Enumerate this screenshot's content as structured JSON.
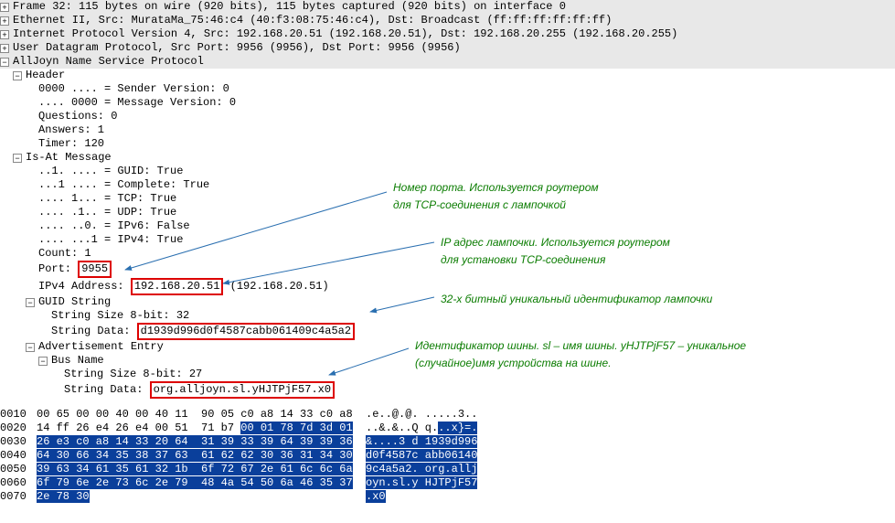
{
  "packet": {
    "frame": "Frame 32: 115 bytes on wire (920 bits), 115 bytes captured (920 bits) on interface 0",
    "eth": "Ethernet II, Src: MurataMa_75:46:c4 (40:f3:08:75:46:c4), Dst: Broadcast (ff:ff:ff:ff:ff:ff)",
    "ip": "Internet Protocol Version 4, Src: 192.168.20.51 (192.168.20.51), Dst: 192.168.20.255 (192.168.20.255)",
    "udp": "User Datagram Protocol, Src Port: 9956 (9956), Dst Port: 9956 (9956)",
    "proto": "AllJoyn Name Service Protocol",
    "header": {
      "label": "Header",
      "sender_version": "0000 .... = Sender Version: 0",
      "message_version": ".... 0000 = Message Version: 0",
      "questions": "Questions: 0",
      "answers": "Answers: 1",
      "timer": "Timer: 120"
    },
    "isat": {
      "label": "Is-At Message",
      "guid": "..1. .... = GUID: True",
      "complete": "...1 .... = Complete: True",
      "tcp": ".... 1... = TCP: True",
      "udp": ".... .1.. = UDP: True",
      "ipv6": ".... ..0. = IPv6: False",
      "ipv4": ".... ...1 = IPv4: True",
      "count": "Count: 1",
      "port_label": "Port: ",
      "port_value": "9955",
      "ipv4_label_pre": "IPv4 Address: ",
      "ipv4_value": "192.168.20.51",
      "ipv4_suffix": " (192.168.20.51)",
      "guidstr": {
        "label": "GUID String",
        "size": "String Size 8-bit: 32",
        "data_pre": "String Data: ",
        "data_val": "d1939d996d0f4587cabb061409c4a5a2"
      },
      "adv": {
        "label": "Advertisement Entry",
        "bus_label": "Bus Name",
        "size": "String Size 8-bit: 27",
        "data_pre": "String Data: ",
        "data_val": "org.alljoyn.sl.yHJTPjF57.x0"
      }
    }
  },
  "annotations": {
    "port1": "Номер порта. Используется роутером",
    "port2": "для TCP-соединения с лампочкой",
    "ip1": "IP адрес лампочки. Используется роутером",
    "ip2": "для установки TCP-соединения",
    "guid1": "32-х битный уникальный идентификатор лампочки",
    "bus1": "Идентификатор шины. sl – имя шины. yHJTPjF57 – уникальное",
    "bus2": "(случайное)имя устройства на шине."
  },
  "hex": [
    {
      "off": "0010",
      "hex": "00 65 00 00 40 00 40 11  90 05 c0 a8 14 33 c0 a8",
      "asc": ".e..@.@. .....3.."
    },
    {
      "off": "0020",
      "hex_a": "14 ff 26 e4 26 e4 00 51  71 b7 ",
      "hex_b": "00 01 78 7d 3d 01",
      "asc_a": "..&.&..Q q.",
      "asc_b": "..x}=."
    },
    {
      "off": "0030",
      "hex_a": "26 e3 c0 a8 14 33 20 64  31 39 33 39 64 39 39 36",
      "asc_a": "&....3 d 1939d996"
    },
    {
      "off": "0040",
      "hex_a": "64 30 66 34 35 38 37 63  61 62 62 30 36 31 34 30",
      "asc_a": "d0f4587c abb06140"
    },
    {
      "off": "0050",
      "hex_a": "39 63 34 61 35 61 32 1b  6f 72 67 2e 61 6c 6c 6a",
      "asc_a": "9c4a5a2. org.allj"
    },
    {
      "off": "0060",
      "hex_a": "6f 79 6e 2e 73 6c 2e 79  48 4a 54 50 6a 46 35 37",
      "asc_a": "oyn.sl.y HJTPjF57"
    },
    {
      "off": "0070",
      "hex_a": "2e 78 30",
      "asc_a": ".x0"
    }
  ]
}
